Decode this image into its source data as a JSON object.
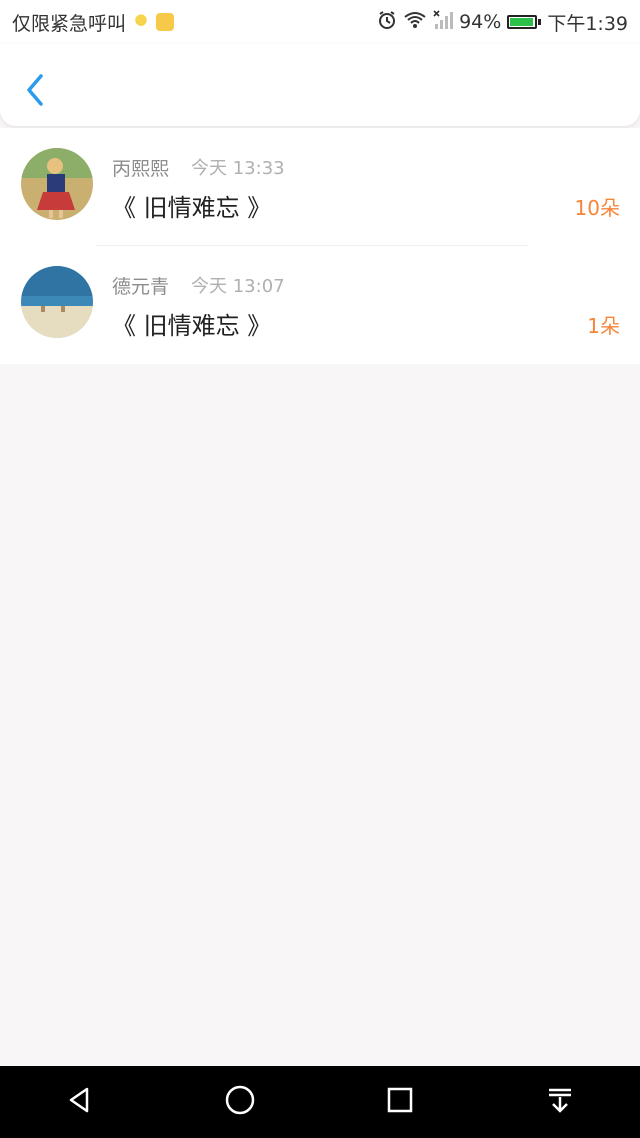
{
  "status_bar": {
    "carrier": "仅限紧急呼叫",
    "battery_percent_text": "94%",
    "time": "下午1:39"
  },
  "header": {
    "back_icon": "chevron-left-icon"
  },
  "items": [
    {
      "name": "丙熙熙",
      "time": "今天 13:33",
      "title": "《 旧情难忘 》",
      "amount": "10朵"
    },
    {
      "name": "德元青",
      "time": "今天 13:07",
      "title": "《 旧情难忘 》",
      "amount": "1朵"
    }
  ],
  "colors": {
    "accent_blue": "#2a9cf0",
    "amount_orange": "#f6853a"
  }
}
